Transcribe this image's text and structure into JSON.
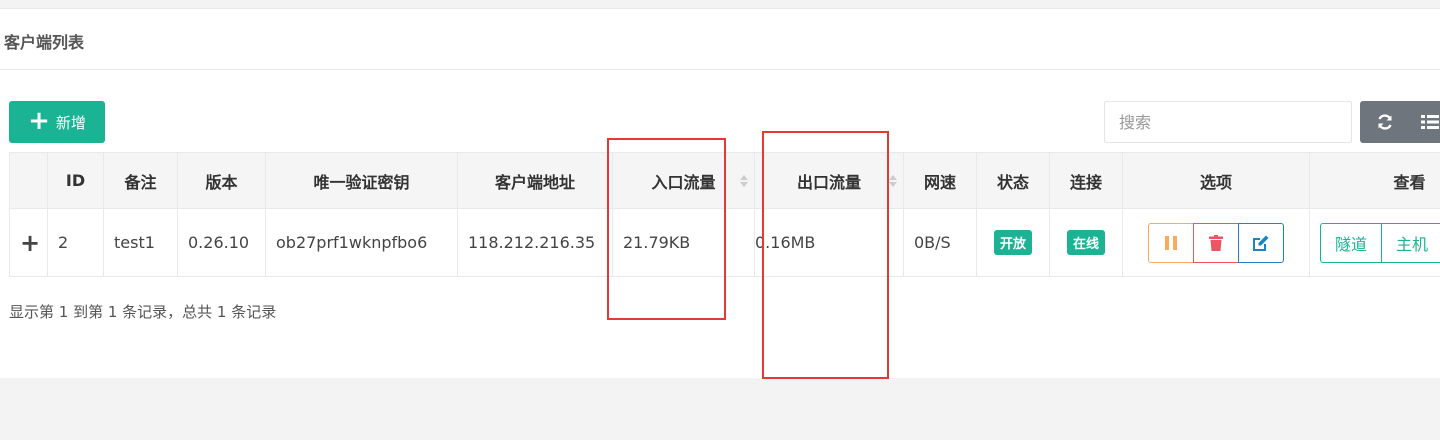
{
  "panel": {
    "title": "客户端列表"
  },
  "toolbar": {
    "add_label": "新增",
    "search_placeholder": "搜索",
    "refresh_icon": "refresh-icon",
    "columns_icon": "list-icon",
    "tool_color": "#6f757c",
    "accent_color": "#1ab394"
  },
  "table": {
    "headers": {
      "id": "ID",
      "remark": "备注",
      "version": "版本",
      "key": "唯一验证密钥",
      "address": "客户端地址",
      "in_flow": "入口流量",
      "out_flow": "出口流量",
      "speed": "网速",
      "status": "状态",
      "connect": "连接",
      "options": "选项",
      "view": "查看"
    },
    "rows": [
      {
        "expand": "+",
        "id": "2",
        "remark": "test1",
        "version": "0.26.10",
        "key": "ob27prf1wknpfbo6",
        "address": "118.212.216.35",
        "in_flow": "21.79KB",
        "out_flow": "0.16MB",
        "speed": "0B/S",
        "status": "开放",
        "connect": "在线",
        "view_tunnel": "隧道",
        "view_host": "主机"
      }
    ]
  },
  "pager": {
    "info": "显示第 1 到第 1 条记录，总共 1 条记录"
  },
  "highlight_color": "#e53935"
}
